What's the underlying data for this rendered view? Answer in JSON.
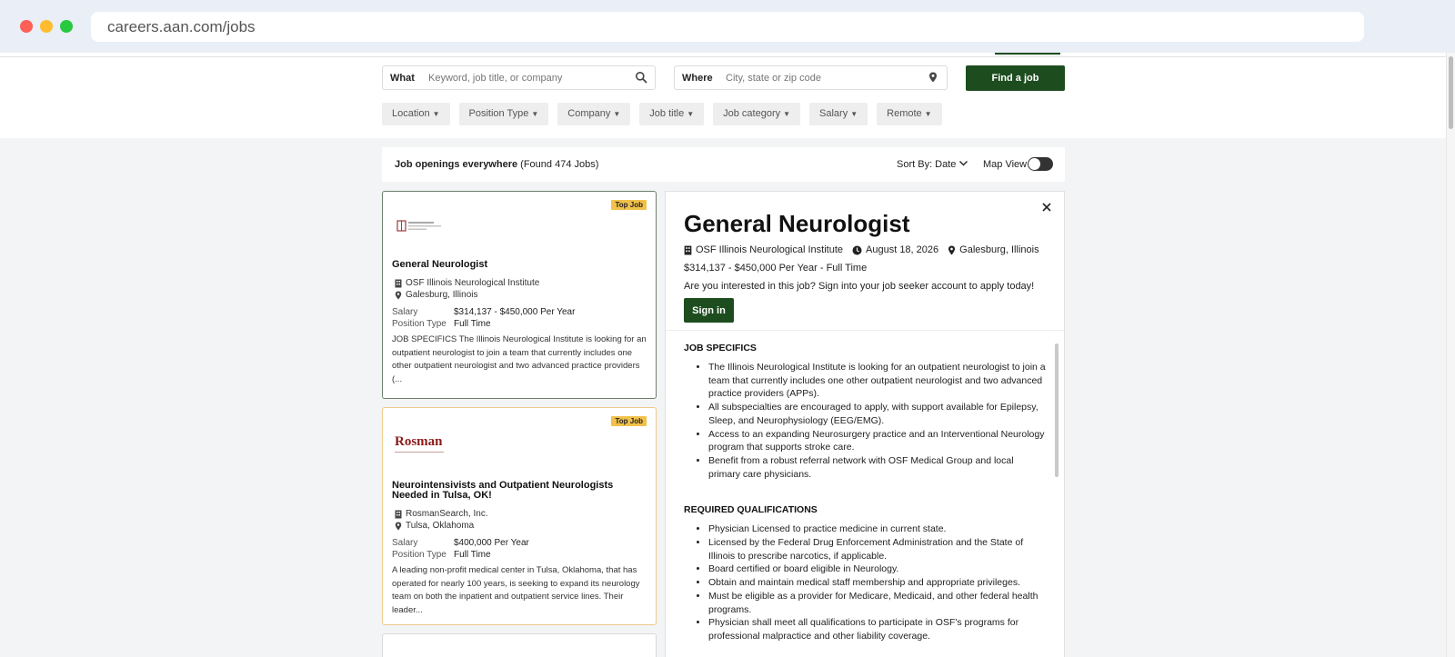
{
  "browser": {
    "url": "careers.aan.com/jobs"
  },
  "search": {
    "what_label": "What",
    "what_placeholder": "Keyword, job title, or company",
    "where_label": "Where",
    "where_placeholder": "City, state or zip code",
    "find_button": "Find a job"
  },
  "filters": [
    "Location",
    "Position Type",
    "Company",
    "Job title",
    "Job category",
    "Salary",
    "Remote"
  ],
  "results": {
    "title": "Job openings everywhere",
    "count": "(Found 474 Jobs)",
    "sort_label": "Sort By: Date",
    "map_view_label": "Map View"
  },
  "jobs": [
    {
      "badge": "Top Job",
      "title": "General Neurologist",
      "company": "OSF Illinois Neurological Institute",
      "location": "Galesburg, Illinois",
      "salary_label": "Salary",
      "salary": "$314,137 - $450,000 Per Year",
      "position_label": "Position Type",
      "position_type": "Full Time",
      "description": "JOB SPECIFICS The Illinois Neurological Institute is looking for an outpatient neurologist to join a team that currently includes one other outpatient neurologist and two advanced practice providers (..."
    },
    {
      "badge": "Top Job",
      "logo_text": "Rosman",
      "title": "Neurointensivists and Outpatient Neurologists Needed in Tulsa, OK!",
      "company": "RosmanSearch, Inc.",
      "location": "Tulsa, Oklahoma",
      "salary_label": "Salary",
      "salary": "$400,000 Per Year",
      "position_label": "Position Type",
      "position_type": "Full Time",
      "description": "A leading non-profit medical center in Tulsa, Oklahoma, that has operated for nearly 100 years, is seeking to expand its neurology team on both the inpatient and outpatient service lines. Their leader..."
    }
  ],
  "detail": {
    "title": "General Neurologist",
    "company": "OSF Illinois Neurological Institute",
    "date": "August 18, 2026",
    "location": "Galesburg, Illinois",
    "salary_line": "$314,137 - $450,000 Per Year - Full Time",
    "interest_text": "Are you interested in this job? Sign into your job seeker account to apply today!",
    "signin_button": "Sign in",
    "sections": [
      {
        "heading": "JOB SPECIFICS",
        "items": [
          "The Illinois Neurological Institute is looking for an outpatient neurologist to join a team that currently includes one other outpatient neurologist and two advanced practice providers (APPs).",
          "All subspecialties are encouraged to apply, with support available for Epilepsy, Sleep, and Neurophysiology (EEG/EMG).",
          "Access to an expanding Neurosurgery practice and an Interventional Neurology program that supports stroke care.",
          "Benefit from a robust referral network with OSF Medical Group and local primary care physicians."
        ]
      },
      {
        "heading": "REQUIRED QUALIFICATIONS",
        "items": [
          "Physician Licensed to practice medicine in current state.",
          "Licensed by the Federal Drug Enforcement Administration and the State of Illinois to prescribe narcotics, if applicable.",
          "Board certified or board eligible in Neurology.",
          "Obtain and maintain medical staff membership and appropriate privileges.",
          "Must be eligible as a provider for Medicare, Medicaid, and other federal health programs.",
          "Physician shall meet all qualifications to participate in OSF's programs for professional malpractice and other liability coverage."
        ]
      }
    ]
  },
  "colors": {
    "brand_green": "#1d4d1f",
    "top_job_badge": "#f2c14a",
    "rosman_red": "#8b1a1a"
  }
}
